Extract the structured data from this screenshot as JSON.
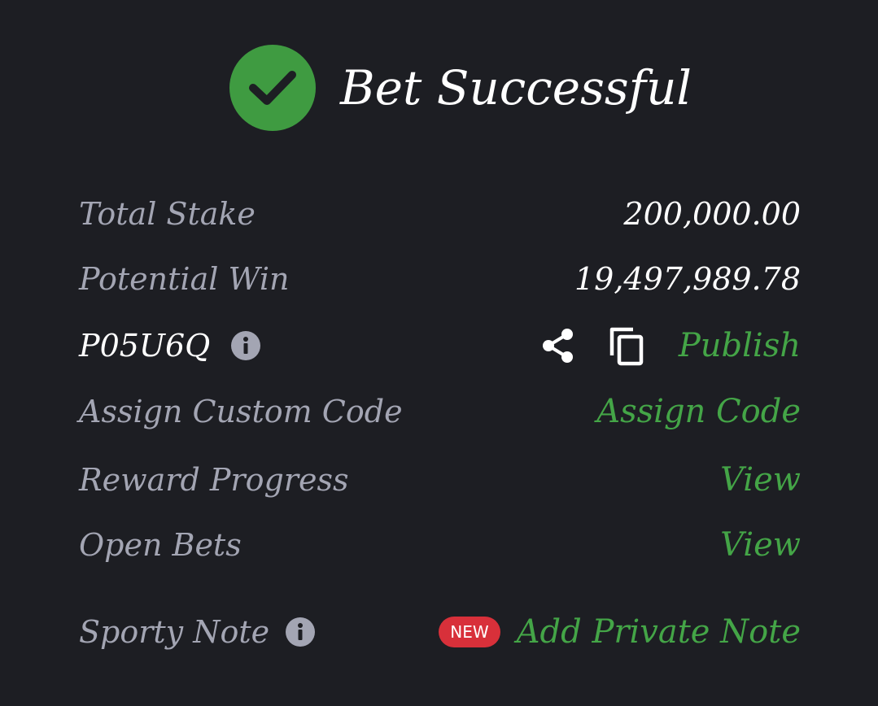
{
  "header": {
    "title": "Bet Successful",
    "icon": "check-circle-icon"
  },
  "rows": {
    "total_stake": {
      "label": "Total Stake",
      "value": "200,000.00"
    },
    "potential_win": {
      "label": "Potential Win",
      "value": "19,497,989.78"
    },
    "booking": {
      "code": "P05U6Q",
      "info_icon": "info-icon",
      "share_icon": "share-icon",
      "copy_icon": "copy-icon",
      "publish_label": "Publish"
    },
    "custom_code": {
      "label": "Assign Custom Code",
      "action": "Assign Code"
    },
    "reward_progress": {
      "label": "Reward Progress",
      "action": "View"
    },
    "open_bets": {
      "label": "Open Bets",
      "action": "View"
    },
    "sporty_note": {
      "label": "Sporty Note",
      "info_icon": "info-icon",
      "badge": "NEW",
      "action": "Add Private Note"
    }
  },
  "colors": {
    "background": "#1d1e23",
    "accent_green": "#44a547",
    "check_green": "#3f9b41",
    "label_gray": "#a3a5b3",
    "badge_red": "#d8303a"
  }
}
